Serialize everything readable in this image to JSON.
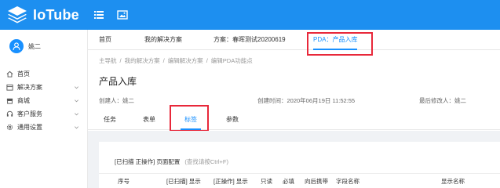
{
  "app": {
    "name": "IoTube",
    "brand_color": "#1d8ff0",
    "accent": "#1890ff"
  },
  "topbar": {
    "icons": [
      "menu-list-icon",
      "image-icon"
    ]
  },
  "sidebar": {
    "user_name": "姚二",
    "items": [
      {
        "icon": "home-icon",
        "label": "首页",
        "has_arrow": false
      },
      {
        "icon": "calendar-icon",
        "label": "解决方案",
        "has_arrow": true
      },
      {
        "icon": "store-icon",
        "label": "商城",
        "has_arrow": true
      },
      {
        "icon": "headset-icon",
        "label": "客户服务",
        "has_arrow": true
      },
      {
        "icon": "settings-icon",
        "label": "通用设置",
        "has_arrow": true
      }
    ]
  },
  "page_tabs": [
    {
      "label": "首页",
      "active": false
    },
    {
      "label": "我的解决方案",
      "active": false
    },
    {
      "label": "方案：春晖测试20200619",
      "active": false
    },
    {
      "label": "PDA：产品入库",
      "active": true
    }
  ],
  "breadcrumb": [
    "主导航",
    "我的解决方案",
    "编辑解决方案",
    "编辑PDA功能点"
  ],
  "breadcrumb_sep": "/",
  "title": "产品入库",
  "meta": {
    "creator_label": "创建人：",
    "creator": "姚二",
    "created_label": "创建时间：",
    "created": "2020年06月19日 11:52:55",
    "modifier_label": "最后修改人：",
    "modifier": "姚二"
  },
  "content_tabs": [
    {
      "label": "任务",
      "active": false
    },
    {
      "label": "表单",
      "active": false
    },
    {
      "label": "标签",
      "active": true
    },
    {
      "label": "参数",
      "active": false
    }
  ],
  "toolbar": {
    "text": "[已扫描 正操作] 页面配置",
    "hint": "(查找请按Ctrl+F)"
  },
  "table": {
    "columns": [
      "序号",
      "[已扫描] 显示",
      "[正操作] 显示",
      "只读",
      "必填",
      "向后携带",
      "字段名称",
      "显示名称"
    ]
  },
  "highlight_color": "#e8283a"
}
